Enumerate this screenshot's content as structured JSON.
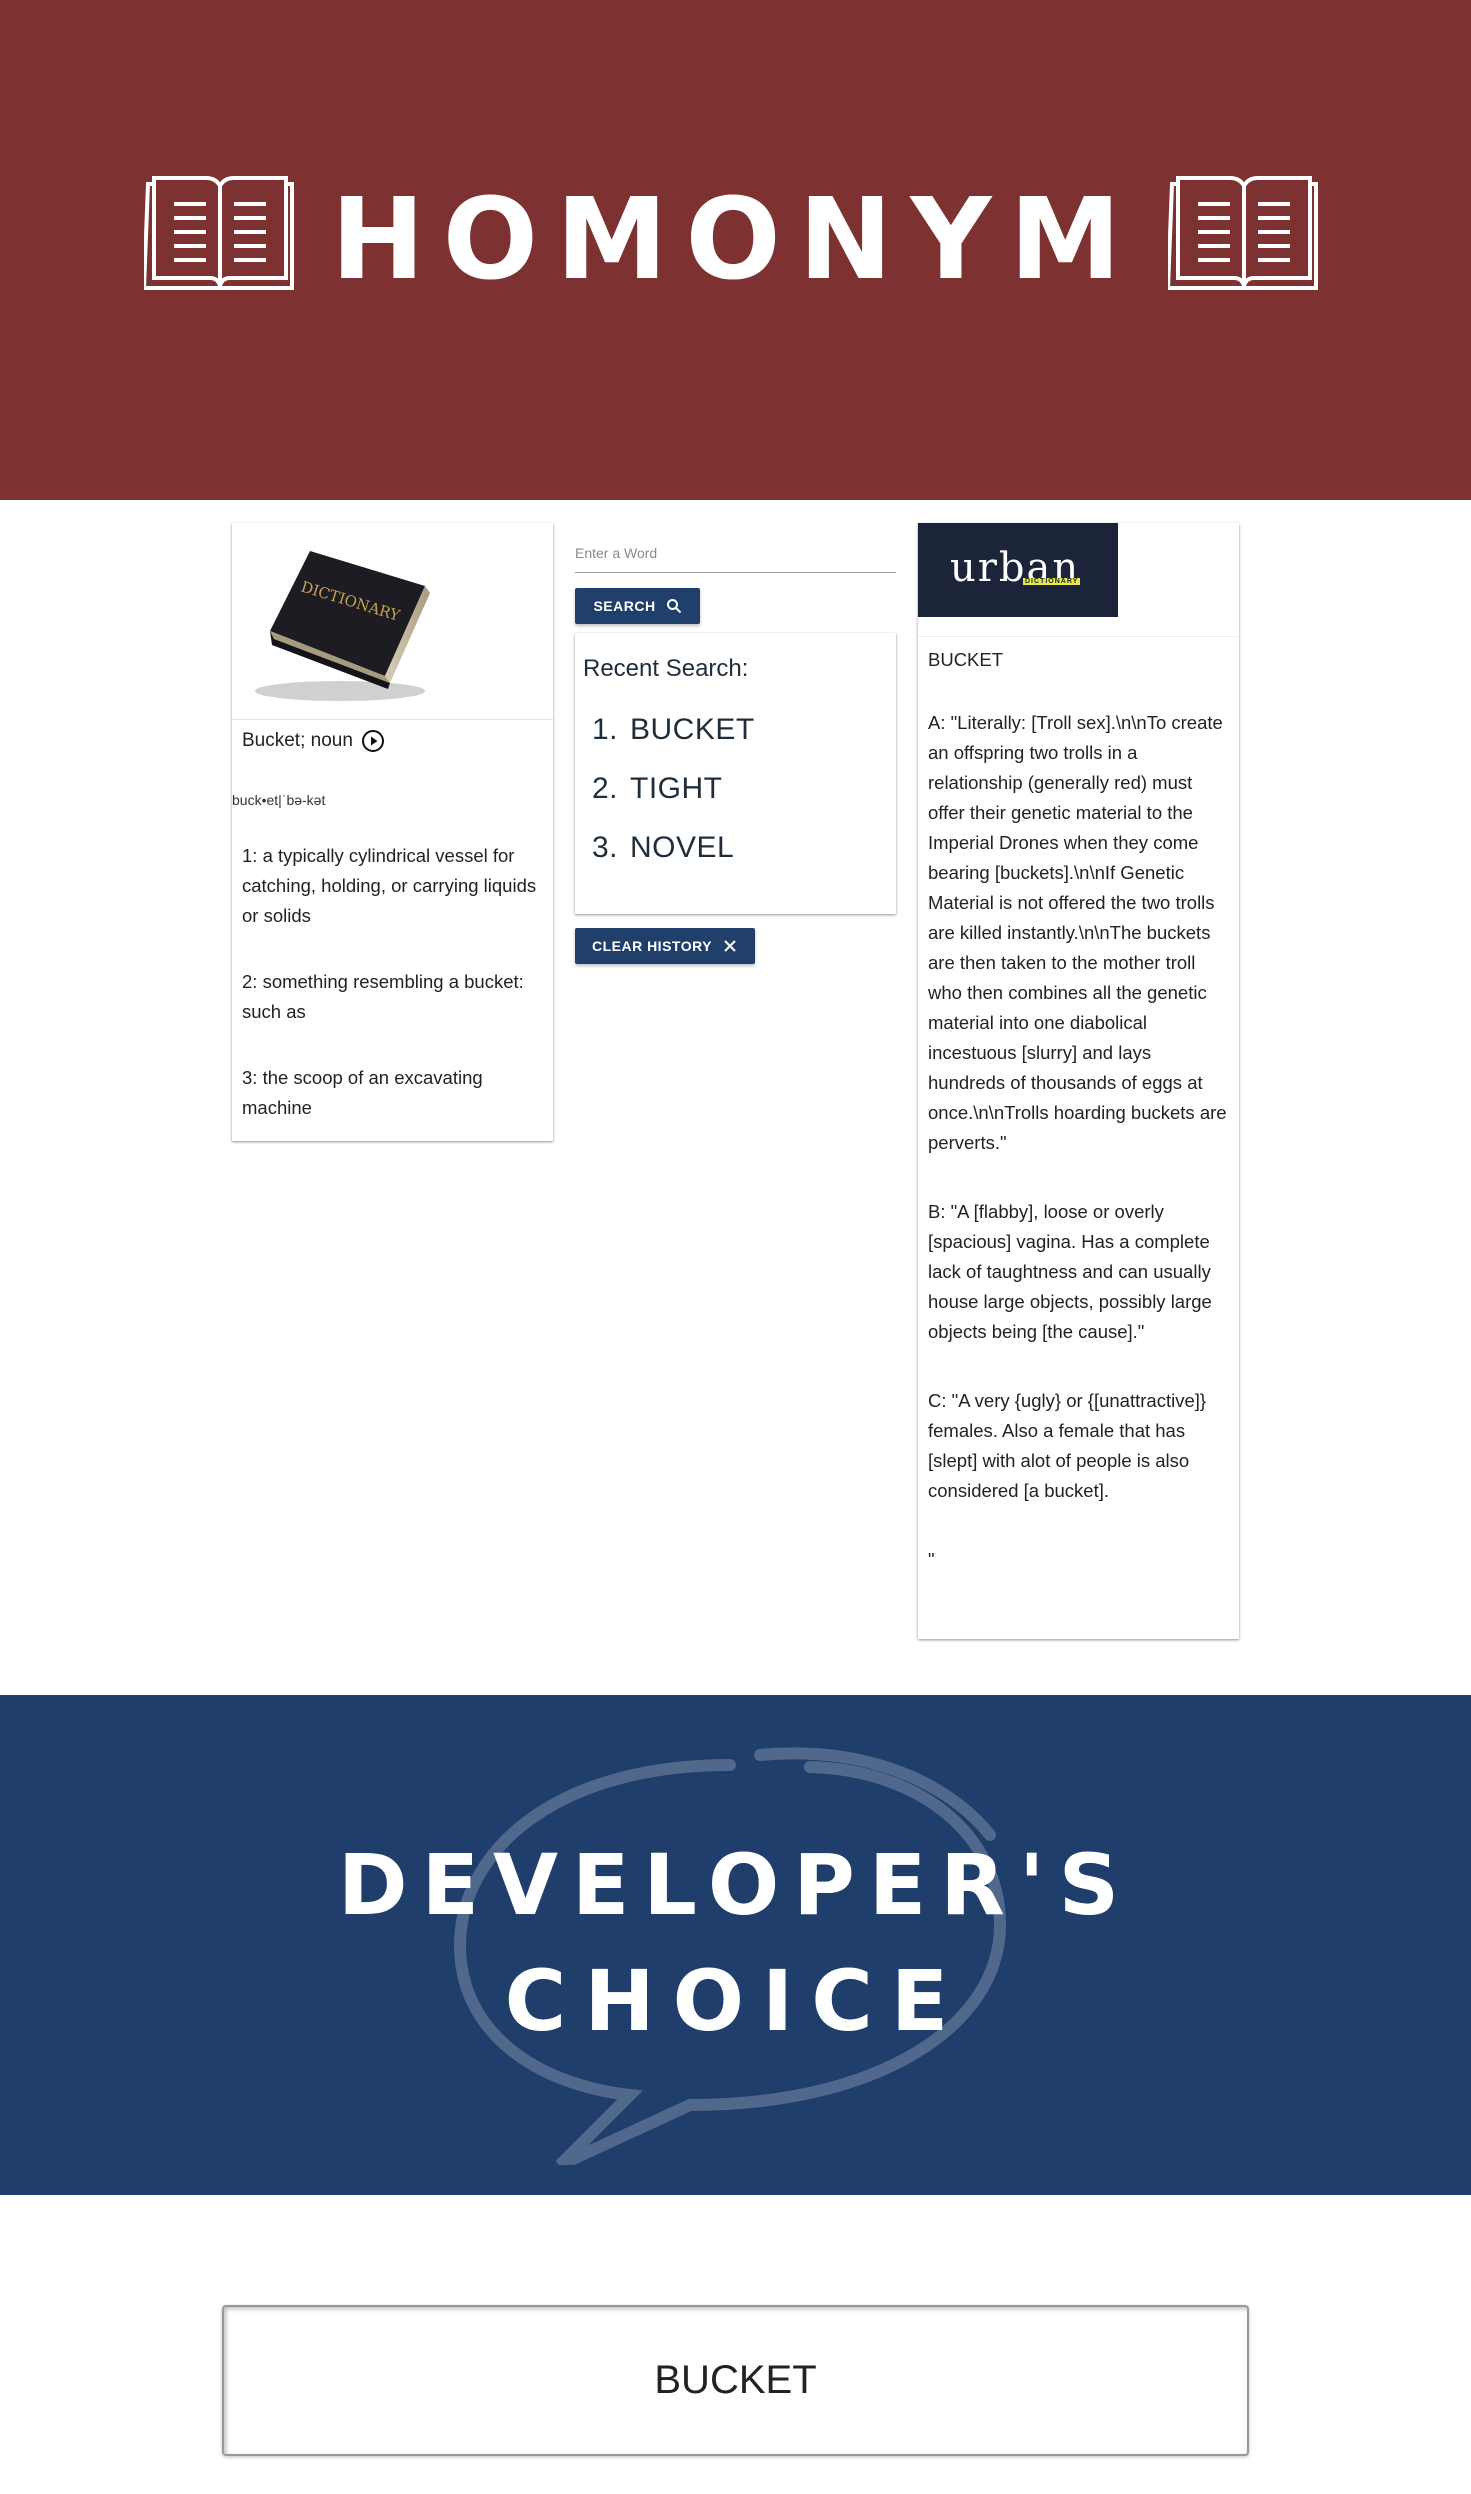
{
  "header": {
    "title": "HOMONYM",
    "bg_color": "#7d3130"
  },
  "dictionary": {
    "image_icon": "dictionary-book-image",
    "word": "Bucket; noun",
    "pronunciation": "buck•et|ˈbə-kət",
    "definitions": [
      "1: a typically cylindrical vessel for catching, holding, or carrying liquids or solids",
      "2: something resembling a bucket: such as",
      "3: the scoop of an excavating machine"
    ]
  },
  "search": {
    "placeholder": "Enter a Word",
    "button_label": "SEARCH",
    "recent_title": "Recent Search:",
    "recent_items": [
      {
        "num": "1.",
        "word": "BUCKET"
      },
      {
        "num": "2.",
        "word": "TIGHT"
      },
      {
        "num": "3.",
        "word": "NOVEL"
      }
    ],
    "clear_label": "CLEAR HISTORY",
    "button_color": "#213f6b"
  },
  "urban": {
    "logo_text": "urban",
    "logo_subtext": "DICTIONARY",
    "heading": "BUCKET",
    "entries": [
      "A: \"Literally: [Troll sex].\\n\\nTo create an offspring two trolls in a relationship (generally red) must offer their genetic material to the Imperial Drones when they come bearing [buckets].\\n\\nIf Genetic Material is not offered the two trolls are killed instantly.\\n\\nThe buckets are then taken to the mother troll who then combines all the genetic material into one diabolical incestuous [slurry] and lays hundreds of thousands of eggs at once.\\n\\nTrolls hoarding buckets are perverts.\"",
      "B: \"A [flabby], loose or overly [spacious] vagina. Has a complete lack of taughtness and can usually house large objects, possibly large objects being [the cause].\"",
      "C: \"A very {ugly} or {[unattractive]} females. Also a female that has [slept] with alot of people is also considered [a bucket].",
      "\""
    ]
  },
  "developers_choice": {
    "line1": "DEVELOPER'S",
    "line2": "CHOICE",
    "bg_color": "#1f3e6b",
    "word": "BUCKET"
  }
}
